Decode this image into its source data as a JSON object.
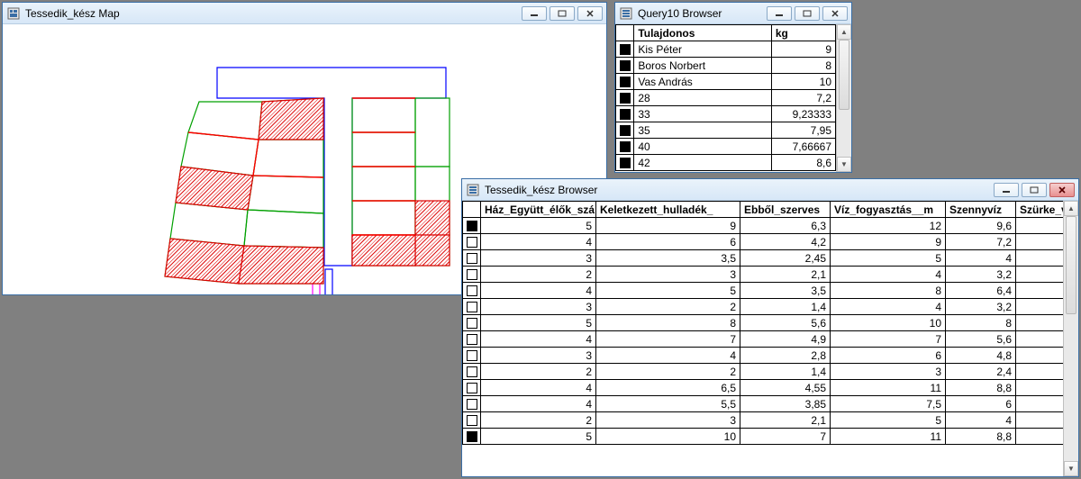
{
  "map_window": {
    "title": "Tessedik_kész Map"
  },
  "query_window": {
    "title": "Query10 Browser",
    "columns": {
      "c0": "Tulajdonos",
      "c1": "kg"
    },
    "rows": [
      {
        "sel": true,
        "c0": "Kis Péter",
        "c1": "9"
      },
      {
        "sel": true,
        "c0": "Boros Norbert",
        "c1": "8"
      },
      {
        "sel": true,
        "c0": "Vas András",
        "c1": "10"
      },
      {
        "sel": true,
        "c0": "28",
        "c1": "7,2"
      },
      {
        "sel": true,
        "c0": "33",
        "c1": "9,23333"
      },
      {
        "sel": true,
        "c0": "35",
        "c1": "7,95"
      },
      {
        "sel": true,
        "c0": "40",
        "c1": "7,66667"
      },
      {
        "sel": true,
        "c0": "42",
        "c1": "8,6"
      }
    ]
  },
  "big_browser": {
    "title": "Tessedik_kész Browser",
    "columns": {
      "c0": "Ház_Együtt_élők_szá",
      "c1": "Keletkezett_hulladék_",
      "c2": "Ebből_szerves",
      "c3": "Víz_fogyasztás__m",
      "c4": "Szennyvíz",
      "c5": "Szürke_víz_v"
    },
    "rows": [
      {
        "sel": true,
        "c0": "5",
        "c1": "9",
        "c2": "6,3",
        "c3": "12",
        "c4": "9,6",
        "c5": ""
      },
      {
        "sel": false,
        "c0": "4",
        "c1": "6",
        "c2": "4,2",
        "c3": "9",
        "c4": "7,2",
        "c5": ""
      },
      {
        "sel": false,
        "c0": "3",
        "c1": "3,5",
        "c2": "2,45",
        "c3": "5",
        "c4": "4",
        "c5": ""
      },
      {
        "sel": false,
        "c0": "2",
        "c1": "3",
        "c2": "2,1",
        "c3": "4",
        "c4": "3,2",
        "c5": ""
      },
      {
        "sel": false,
        "c0": "4",
        "c1": "5",
        "c2": "3,5",
        "c3": "8",
        "c4": "6,4",
        "c5": ""
      },
      {
        "sel": false,
        "c0": "3",
        "c1": "2",
        "c2": "1,4",
        "c3": "4",
        "c4": "3,2",
        "c5": ""
      },
      {
        "sel": false,
        "c0": "5",
        "c1": "8",
        "c2": "5,6",
        "c3": "10",
        "c4": "8",
        "c5": ""
      },
      {
        "sel": false,
        "c0": "4",
        "c1": "7",
        "c2": "4,9",
        "c3": "7",
        "c4": "5,6",
        "c5": ""
      },
      {
        "sel": false,
        "c0": "3",
        "c1": "4",
        "c2": "2,8",
        "c3": "6",
        "c4": "4,8",
        "c5": ""
      },
      {
        "sel": false,
        "c0": "2",
        "c1": "2",
        "c2": "1,4",
        "c3": "3",
        "c4": "2,4",
        "c5": ""
      },
      {
        "sel": false,
        "c0": "4",
        "c1": "6,5",
        "c2": "4,55",
        "c3": "11",
        "c4": "8,8",
        "c5": ""
      },
      {
        "sel": false,
        "c0": "4",
        "c1": "5,5",
        "c2": "3,85",
        "c3": "7,5",
        "c4": "6",
        "c5": ""
      },
      {
        "sel": false,
        "c0": "2",
        "c1": "3",
        "c2": "2,1",
        "c3": "5",
        "c4": "4",
        "c5": ""
      },
      {
        "sel": true,
        "c0": "5",
        "c1": "10",
        "c2": "7",
        "c3": "11",
        "c4": "8,8",
        "c5": ""
      }
    ]
  }
}
